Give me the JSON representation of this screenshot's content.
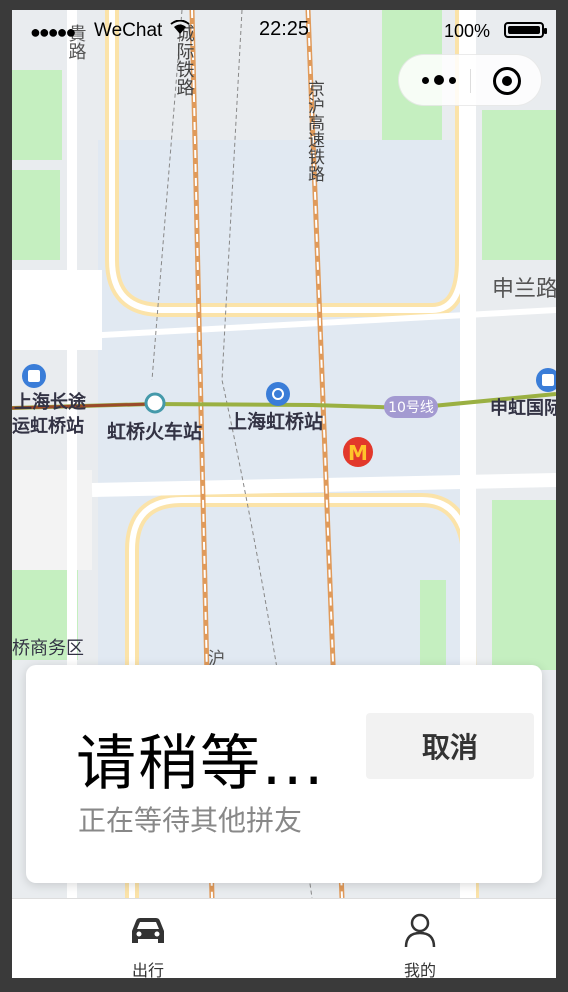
{
  "status_bar": {
    "signal": "●●●●●",
    "carrier": "WeChat",
    "time": "22:25",
    "battery_pct_text": "100%",
    "battery_level": 1.0
  },
  "capsule": {
    "more_icon": "more-dots-icon",
    "close_icon": "target-close-icon"
  },
  "map": {
    "labels": {
      "railway_1": "城际铁路",
      "railway_2": "京沪高速铁路",
      "road_shenlan": "申兰路",
      "station_hongqiao_rail": "虹桥火车站",
      "station_shanghai_hongqiao": "上海虹桥站",
      "line_10": "10号线",
      "shenhong": "申虹国际",
      "changtu": "上海长途",
      "yun_hongqiao": "运虹桥站",
      "hongqiao_business": "桥商务区",
      "hu": "沪",
      "street_gui": "貴路"
    },
    "icons": [
      "metro-icon",
      "train-station-icon",
      "mcdonalds-icon",
      "bus-icon"
    ],
    "colors": {
      "base": "#e4ebf3",
      "road": "#ffffff",
      "road_major": "#fbe3a9",
      "rail": "#e09a5a",
      "green": "#c5efc0",
      "line_10": "#a39ad1",
      "metro_line": "#9ab042"
    }
  },
  "card": {
    "title": "请稍等...",
    "subtitle": "正在等待其他拼友",
    "cancel_label": "取消"
  },
  "tabbar": {
    "tabs": [
      {
        "label": "出行",
        "icon": "car-icon",
        "active": true
      },
      {
        "label": "我的",
        "icon": "user-icon",
        "active": false
      }
    ]
  }
}
